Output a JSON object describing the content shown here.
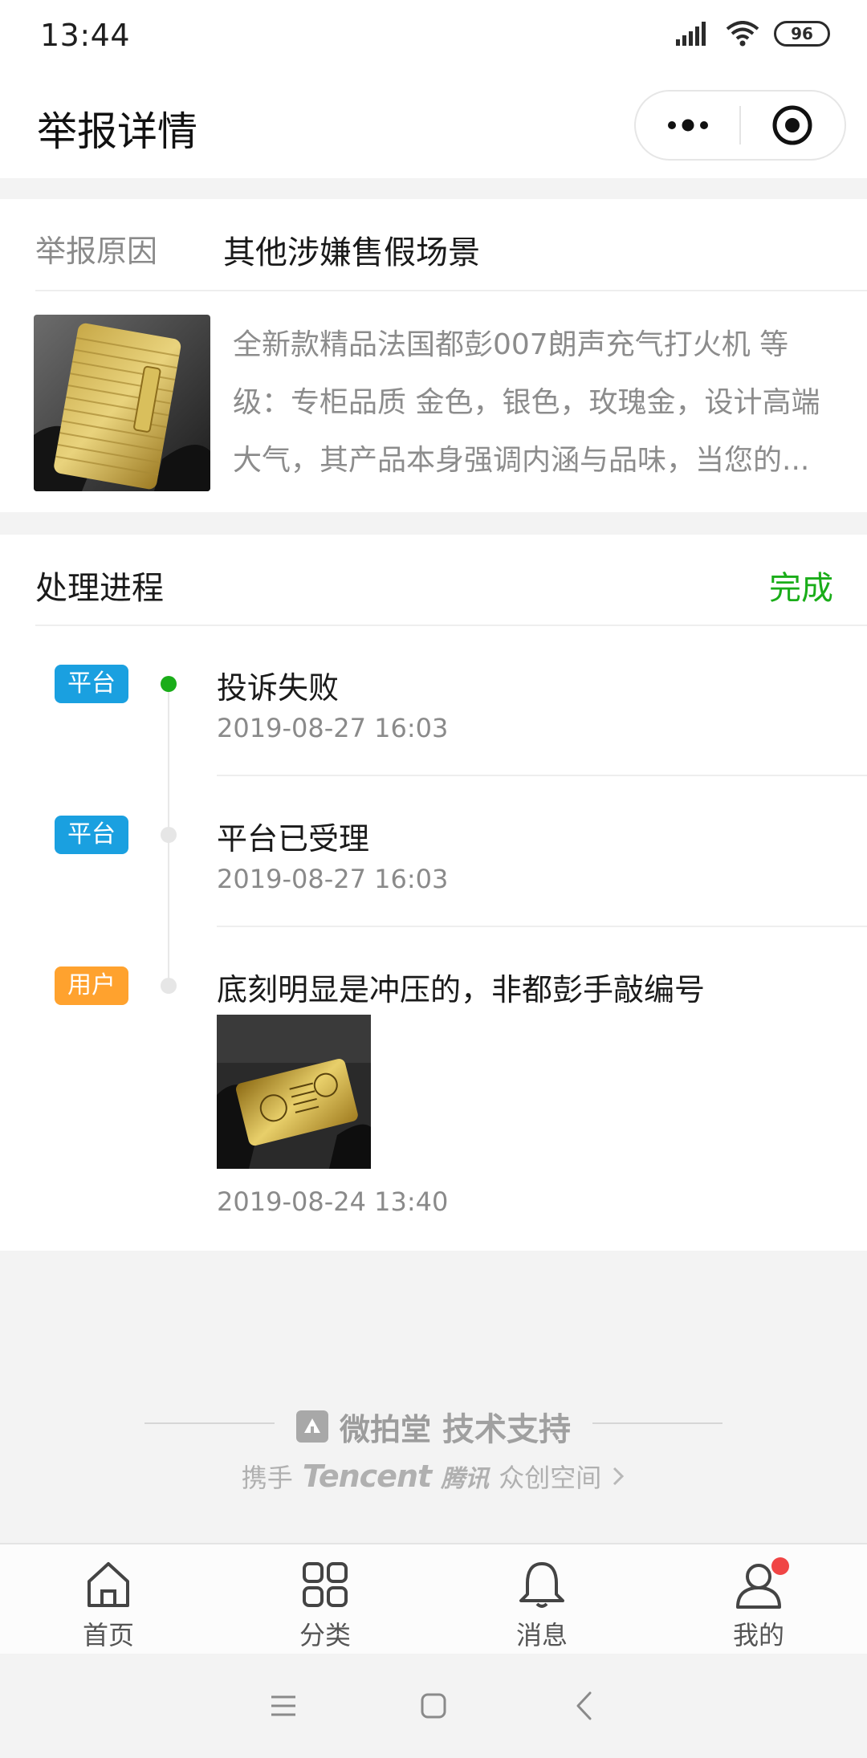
{
  "status_bar": {
    "time": "13:44",
    "battery": "96",
    "icons": [
      "signal-icon",
      "wifi-icon",
      "battery-icon"
    ]
  },
  "nav": {
    "title": "举报详情",
    "capsule": [
      "more-icon",
      "close-miniprogram-icon"
    ]
  },
  "report": {
    "reason_label": "举报原因",
    "reason_value": "其他涉嫌售假场景",
    "description": "全新款精品法国都彭007朗声充气打火机 等级：专柜品质 金色，银色，玫瑰金，设计高端大气，其产品本身强调内涵与品味，当您的..."
  },
  "progress": {
    "title": "处理进程",
    "status": "完成",
    "status_color": "#1aad19",
    "items": [
      {
        "badge": "平台",
        "badge_color": "#1aa0e0",
        "title": "投诉失败",
        "time": "2019-08-27 16:03",
        "active": true
      },
      {
        "badge": "平台",
        "badge_color": "#1aa0e0",
        "title": "平台已受理",
        "time": "2019-08-27 16:03",
        "active": false
      },
      {
        "badge": "用户",
        "badge_color": "#ffa22e",
        "title": "底刻明显是冲压的，非都彭手敲编号",
        "time": "2019-08-24 13:40",
        "active": false
      }
    ]
  },
  "support": {
    "brand": "微拍堂",
    "text": "技术支持",
    "sub_prefix": "携手",
    "tencent_en": "Tencent",
    "tencent_cn": "腾讯",
    "sub_suffix": "众创空间"
  },
  "tabs": [
    {
      "label": "首页",
      "icon": "home-icon"
    },
    {
      "label": "分类",
      "icon": "category-icon"
    },
    {
      "label": "消息",
      "icon": "bell-icon"
    },
    {
      "label": "我的",
      "icon": "profile-icon",
      "has_badge": true
    }
  ],
  "system_nav": [
    "menu-icon",
    "home-square-icon",
    "back-icon"
  ]
}
